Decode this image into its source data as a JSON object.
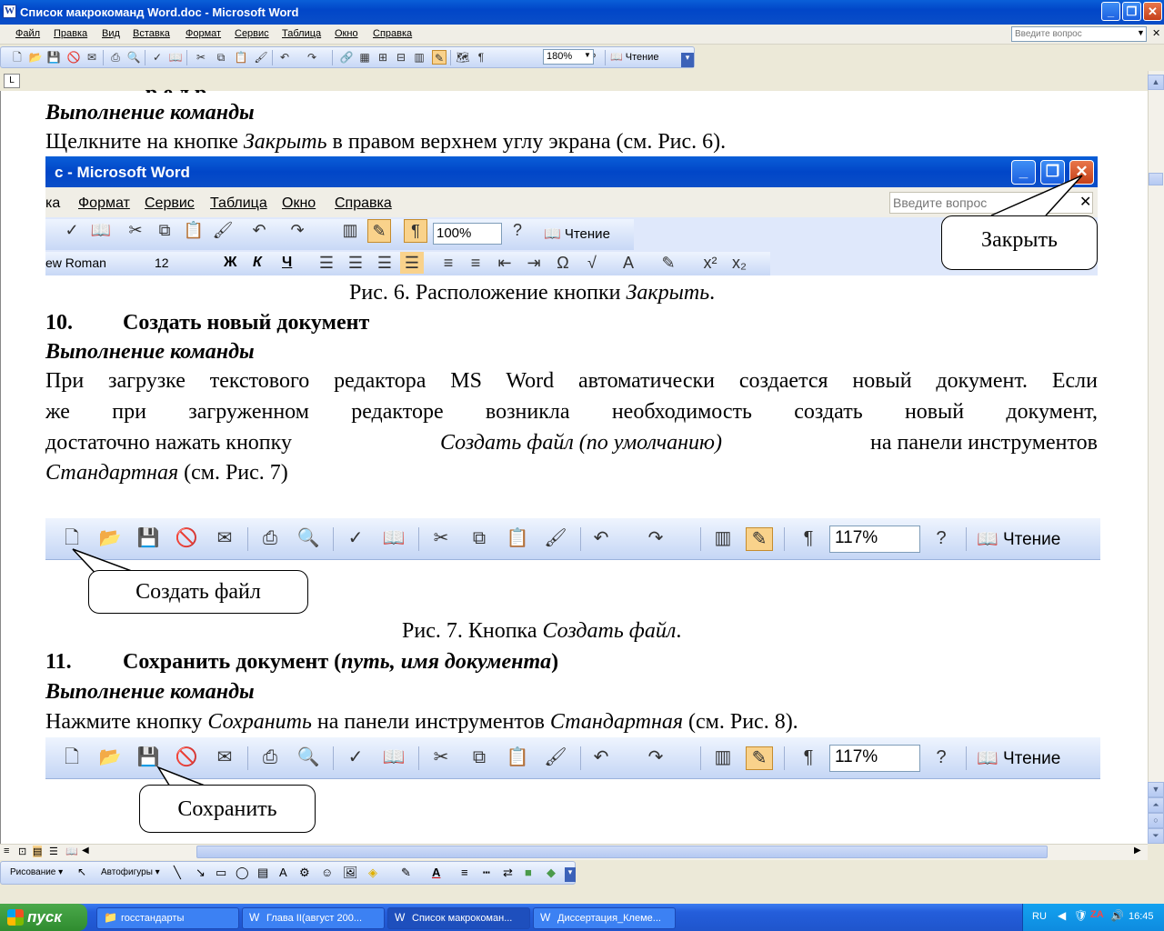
{
  "window": {
    "title": "Список макрокоманд Word.doc - Microsoft Word",
    "icon": "word-doc-icon"
  },
  "menu": [
    "Файл",
    "Правка",
    "Вид",
    "Вставка",
    "Формат",
    "Сервис",
    "Таблица",
    "Окно",
    "Справка"
  ],
  "ask_placeholder": "Введите вопрос",
  "toolbar": {
    "zoom": "180%",
    "read_label": "Чтение"
  },
  "ruler_tab": "L",
  "doc": {
    "exec_heading": "Выполнение команды",
    "step9_text_a": "Щелкните на кнопке ",
    "step9_text_em": "Закрыть",
    "step9_text_b": " в правом верхнем углу экрана (см. Рис. 6).",
    "fig6": {
      "title": "c - Microsoft Word",
      "menu": [
        "ка",
        "Формат",
        "Сервис",
        "Таблица",
        "Окно",
        "Справка"
      ],
      "ask": "Введите вопрос",
      "zoom": "100%",
      "read": "Чтение",
      "font": "ew Roman",
      "size": "12",
      "fmt": [
        "Ж",
        "К",
        "Ч"
      ],
      "callout": "Закрыть"
    },
    "cap6_a": "Рис. 6. Расположение кнопки ",
    "cap6_em": "Закрыть",
    "cap6_b": ".",
    "h10_num": "10.",
    "h10_title": "Создать новый документ",
    "exec10": "Выполнение команды",
    "p10_l1": "При загрузке текстового редактора MS Word автоматически создается новый документ. Если",
    "p10_l2": "же при загруженном редакторе возникла необходимость создать новый документ,",
    "p10_l3a": "достаточно нажать кнопку ",
    "p10_l3em": "Создать файл (по умолчанию)",
    "p10_l3b": " на панели инструментов",
    "p10_l4em": "Стандартная",
    "p10_l4b": " (см. Рис. 7)",
    "fig7": {
      "zoom": "117%",
      "read": "Чтение",
      "callout": "Создать файл"
    },
    "cap7_a": "Рис. 7. Кнопка ",
    "cap7_em": "Создать файл",
    "cap7_b": ".",
    "h11_num": "11.",
    "h11_title_a": "Сохранить документ (",
    "h11_title_em": "путь, имя документа",
    "h11_title_b": ")",
    "exec11": "Выполнение команды",
    "p11_a": "Нажмите кнопку ",
    "p11_em1": "Сохранить",
    "p11_b": " на панели инструментов ",
    "p11_em2": "Стандартная",
    "p11_c": " (см. Рис. 8).",
    "fig8": {
      "zoom": "117%",
      "read": "Чтение",
      "callout": "Сохранить"
    }
  },
  "drawbar": {
    "draw_label": "Рисование",
    "autoshapes_label": "Автофигуры"
  },
  "taskbar": {
    "start": "пуск",
    "tasks": [
      "госстандарты",
      "Глава II(август 200...",
      "Список макрокоман...",
      "Диссертация_Клеме..."
    ],
    "lang": "RU",
    "clock": "16:45"
  }
}
